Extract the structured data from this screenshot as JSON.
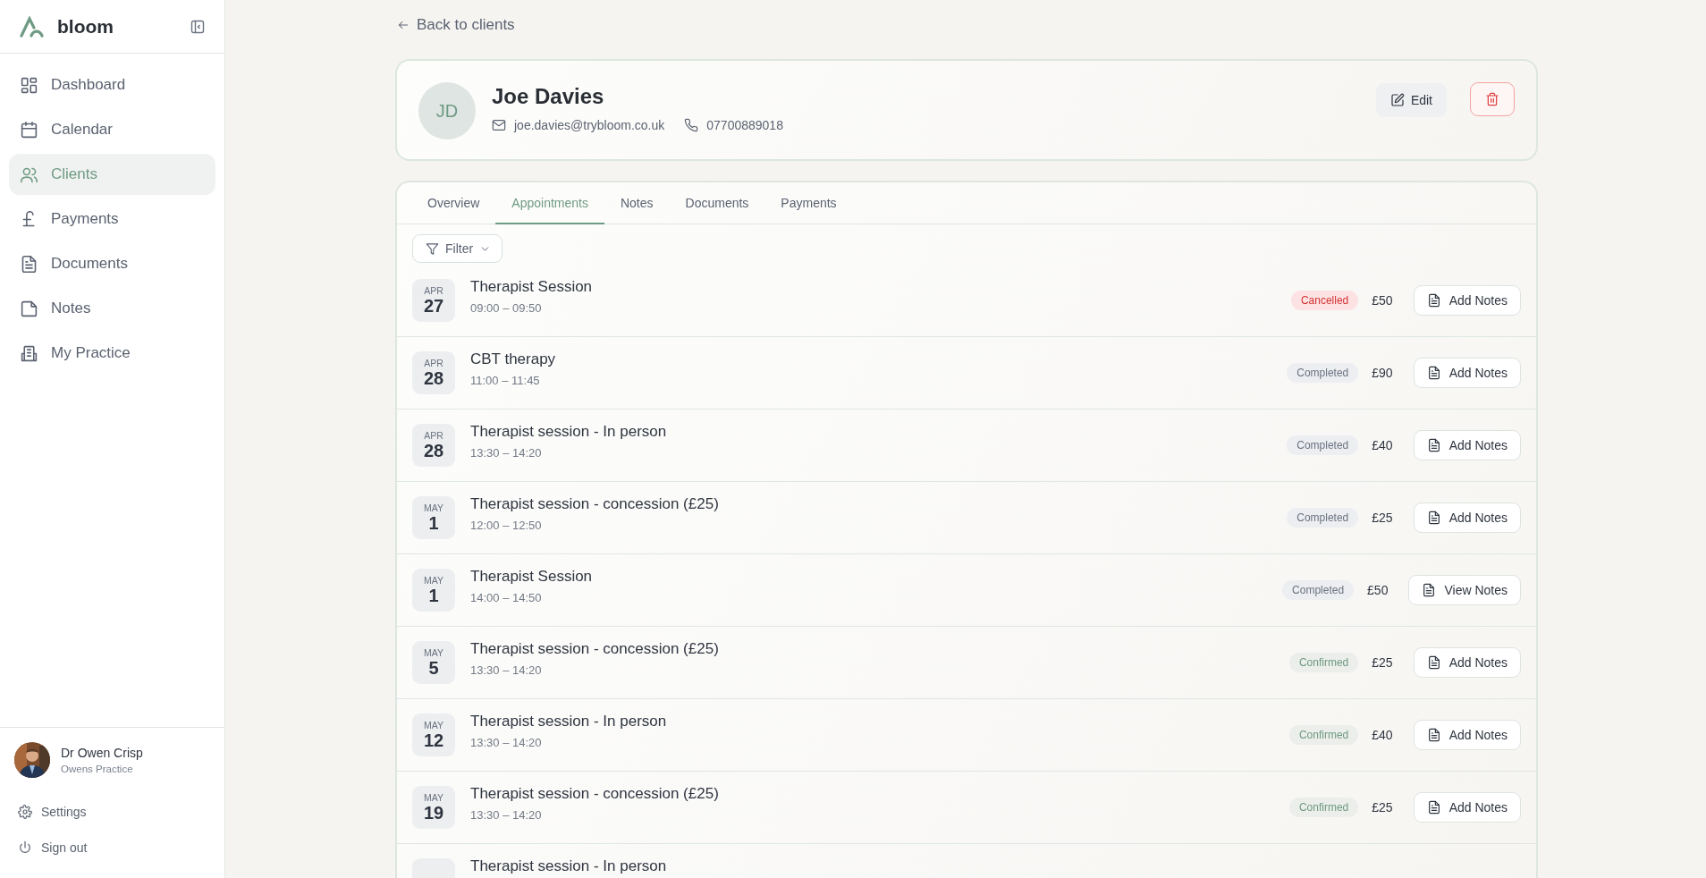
{
  "sidebar": {
    "brand": "bloom",
    "items": [
      {
        "label": "Dashboard",
        "selected": false
      },
      {
        "label": "Calendar",
        "selected": false
      },
      {
        "label": "Clients",
        "selected": true
      },
      {
        "label": "Payments",
        "selected": false
      },
      {
        "label": "Documents",
        "selected": false
      },
      {
        "label": "Notes",
        "selected": false
      },
      {
        "label": "My Practice",
        "selected": false
      }
    ],
    "user": {
      "name": "Dr Owen Crisp",
      "practice": "Owens Practice"
    },
    "footer_links": [
      {
        "label": "Settings"
      },
      {
        "label": "Sign out"
      }
    ]
  },
  "back_link": "Back to clients",
  "client": {
    "initials": "JD",
    "name": "Joe Davies",
    "email": "joe.davies@trybloom.co.uk",
    "phone": "07700889018",
    "edit_button": "Edit"
  },
  "tabs": [
    {
      "label": "Overview",
      "selected": false
    },
    {
      "label": "Appointments",
      "selected": true
    },
    {
      "label": "Notes",
      "selected": false
    },
    {
      "label": "Documents",
      "selected": false
    },
    {
      "label": "Payments",
      "selected": false
    }
  ],
  "filter": {
    "label": "Filter"
  },
  "appointments": [
    {
      "month": "APR",
      "day": "27",
      "title": "Therapist Session",
      "time": "09:00 – 09:50",
      "status": "Cancelled",
      "kind": "cancelled",
      "price": "£50",
      "action": "Add Notes"
    },
    {
      "month": "APR",
      "day": "28",
      "title": "CBT therapy",
      "time": "11:00 – 11:45",
      "status": "Completed",
      "kind": "completed",
      "price": "£90",
      "action": "Add Notes"
    },
    {
      "month": "APR",
      "day": "28",
      "title": "Therapist session - In person",
      "time": "13:30 – 14:20",
      "status": "Completed",
      "kind": "completed",
      "price": "£40",
      "action": "Add Notes"
    },
    {
      "month": "MAY",
      "day": "1",
      "title": "Therapist session - concession (£25)",
      "time": "12:00 – 12:50",
      "status": "Completed",
      "kind": "completed",
      "price": "£25",
      "action": "Add Notes"
    },
    {
      "month": "MAY",
      "day": "1",
      "title": "Therapist Session",
      "time": "14:00 – 14:50",
      "status": "Completed",
      "kind": "completed",
      "price": "£50",
      "action": "View Notes"
    },
    {
      "month": "MAY",
      "day": "5",
      "title": "Therapist session - concession (£25)",
      "time": "13:30 – 14:20",
      "status": "Confirmed",
      "kind": "confirmed",
      "price": "£25",
      "action": "Add Notes"
    },
    {
      "month": "MAY",
      "day": "12",
      "title": "Therapist session - In person",
      "time": "13:30 – 14:20",
      "status": "Confirmed",
      "kind": "confirmed",
      "price": "£40",
      "action": "Add Notes"
    },
    {
      "month": "MAY",
      "day": "19",
      "title": "Therapist session - concession (£25)",
      "time": "13:30 – 14:20",
      "status": "Confirmed",
      "kind": "confirmed",
      "price": "£25",
      "action": "Add Notes"
    },
    {
      "title": "Therapist session - In person"
    }
  ]
}
